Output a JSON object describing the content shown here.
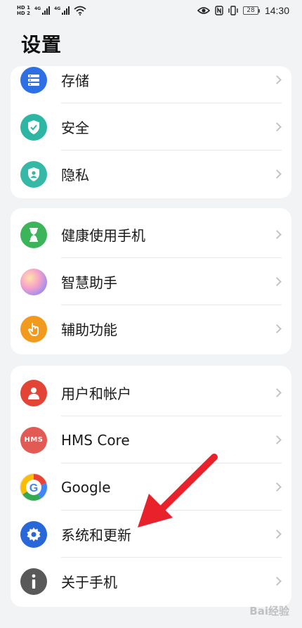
{
  "status_bar": {
    "sim1_tag": "HD 1",
    "sim2_tag": "HD 2",
    "net1": "4G",
    "net2": "4G",
    "battery_level": "28",
    "time": "14:30"
  },
  "header": {
    "title": "设置"
  },
  "groups": [
    {
      "items": [
        {
          "label": "存储",
          "icon": "storage-icon",
          "color": "#2f6fe4"
        },
        {
          "label": "安全",
          "icon": "security-shield-icon",
          "color": "#2db6a3"
        },
        {
          "label": "隐私",
          "icon": "privacy-shield-icon",
          "color": "#35b9a6"
        }
      ]
    },
    {
      "items": [
        {
          "label": "健康使用手机",
          "icon": "hourglass-icon",
          "color": "#3bb45a"
        },
        {
          "label": "智慧助手",
          "icon": "smart-assistant-icon",
          "color": "#d68ad8"
        },
        {
          "label": "辅助功能",
          "icon": "hand-tap-icon",
          "color": "#f29a1e"
        }
      ]
    },
    {
      "items": [
        {
          "label": "用户和帐户",
          "icon": "user-icon",
          "color": "#e24535"
        },
        {
          "label": "HMS Core",
          "icon": "hms-core-icon",
          "color": "#e25a54",
          "badge": "HMS"
        },
        {
          "label": "Google",
          "icon": "google-icon",
          "color": "#ffffff"
        },
        {
          "label": "系统和更新",
          "icon": "gear-icon",
          "color": "#2767d8"
        },
        {
          "label": "关于手机",
          "icon": "info-icon",
          "color": "#595959"
        }
      ]
    }
  ],
  "watermark": "Bai经验"
}
